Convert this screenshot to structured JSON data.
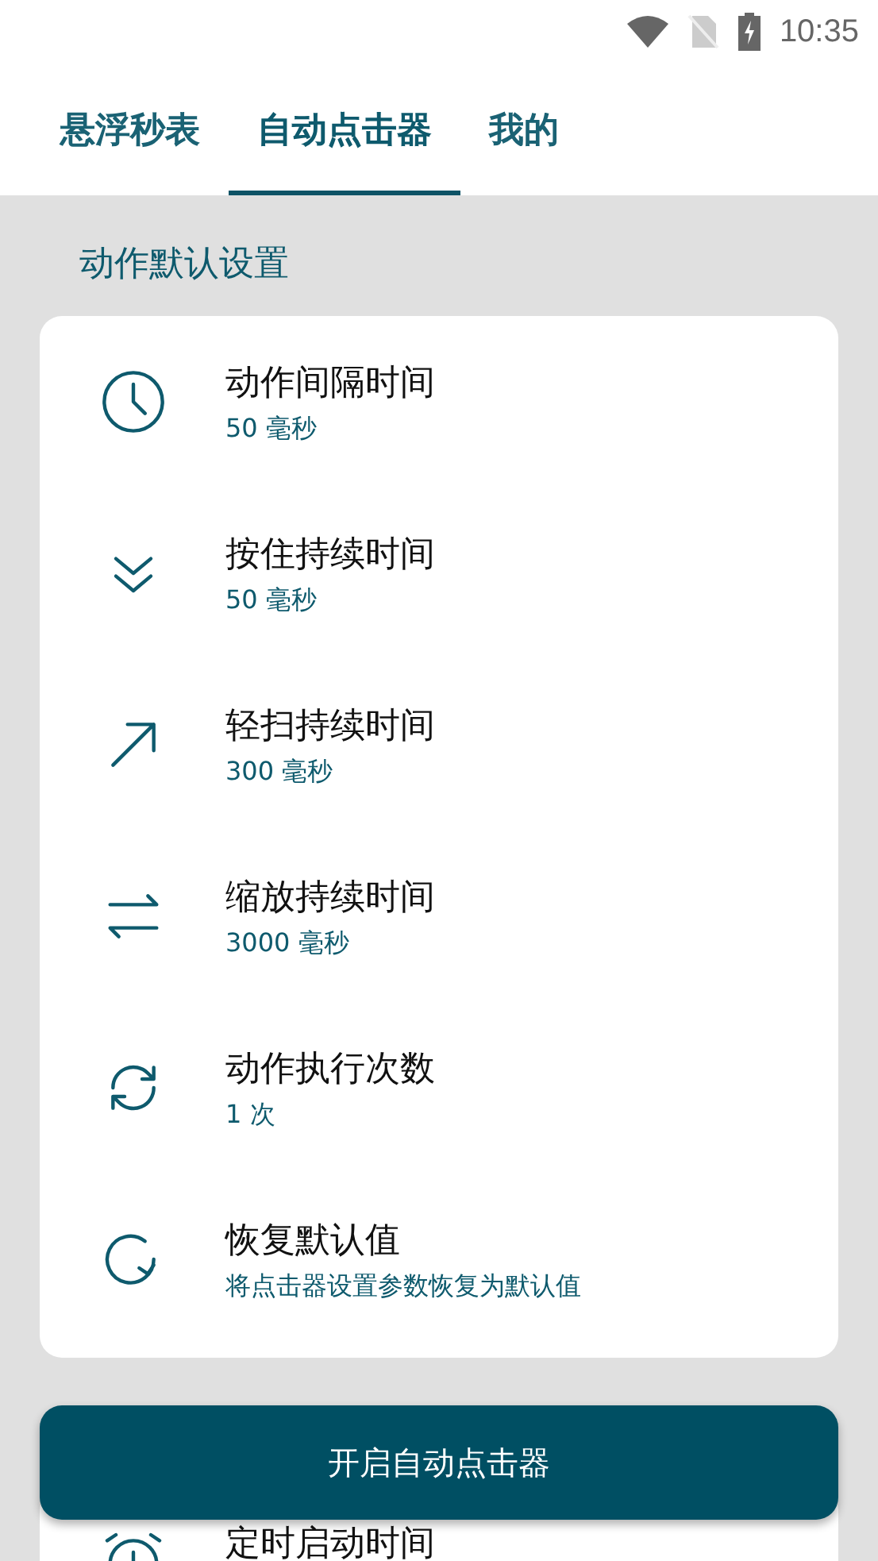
{
  "status_bar": {
    "time": "10:35"
  },
  "tabs": [
    {
      "label": "悬浮秒表",
      "selected": false
    },
    {
      "label": "自动点击器",
      "selected": true
    },
    {
      "label": "我的",
      "selected": false
    }
  ],
  "sections": [
    {
      "title": "动作默认设置",
      "items": [
        {
          "title": "动作间隔时间",
          "subtitle": "50 毫秒"
        },
        {
          "title": "按住持续时间",
          "subtitle": "50 毫秒"
        },
        {
          "title": "轻扫持续时间",
          "subtitle": "300 毫秒"
        },
        {
          "title": "缩放持续时间",
          "subtitle": "3000 毫秒"
        },
        {
          "title": "动作执行次数",
          "subtitle": "1 次"
        },
        {
          "title": "恢复默认值",
          "subtitle": "将点击器设置参数恢复为默认值"
        }
      ]
    },
    {
      "items": [
        {
          "title": "定时启动时间"
        }
      ]
    }
  ],
  "primary_button": "开启自动点击器"
}
